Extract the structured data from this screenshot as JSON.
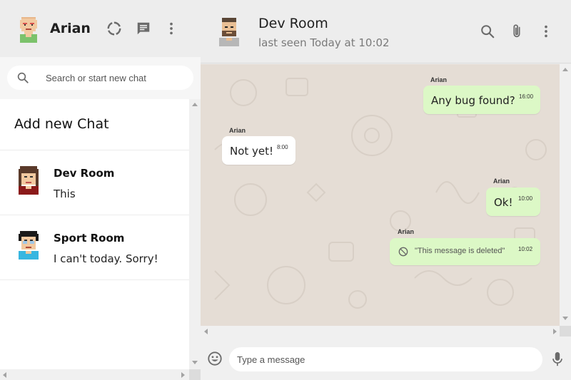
{
  "sidebar": {
    "user": {
      "name": "Arian"
    },
    "search": {
      "placeholder": "Search or start new chat"
    },
    "add_new_chat_label": "Add new Chat",
    "chats": [
      {
        "name": "Dev Room",
        "last_message": "This"
      },
      {
        "name": "Sport Room",
        "last_message": "I can't today. Sorry!"
      }
    ],
    "icons": [
      "status-icon",
      "new-chat-icon",
      "menu-icon",
      "search-icon"
    ]
  },
  "conversation": {
    "room_name": "Dev Room",
    "status": "last seen Today at 10:02",
    "icons": [
      "search-icon",
      "attach-icon",
      "menu-icon",
      "emoji-icon",
      "mic-icon"
    ],
    "messages": [
      {
        "sender": "Arian",
        "text": "Any bug found?",
        "time": "16:00",
        "direction": "outgoing"
      },
      {
        "sender": "Arian",
        "text": "Not yet!",
        "time": "8:00",
        "direction": "incoming"
      },
      {
        "sender": "Arian",
        "text": "Ok!",
        "time": "10:00",
        "direction": "outgoing"
      },
      {
        "sender": "Arian",
        "text": "\"This message is deleted\"",
        "time": "10:02",
        "direction": "outgoing",
        "deleted": true
      }
    ],
    "composer": {
      "placeholder": "Type a message"
    }
  },
  "colors": {
    "header_bg": "#ededed",
    "chat_bg": "#e5ddd5",
    "outgoing_bubble": "#dcf8c6",
    "incoming_bubble": "#ffffff",
    "icon_gray": "#6b6b6b"
  }
}
